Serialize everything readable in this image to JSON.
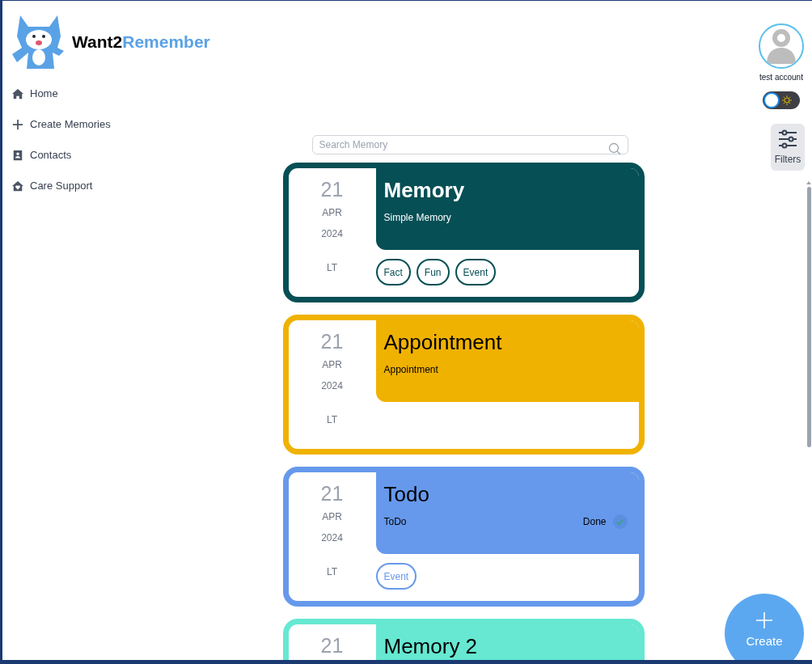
{
  "brand": {
    "part1": "Want2",
    "part2": "Remember"
  },
  "nav": [
    {
      "label": "Home"
    },
    {
      "label": "Create Memories"
    },
    {
      "label": "Contacts"
    },
    {
      "label": "Care Support"
    }
  ],
  "account": {
    "name": "test account"
  },
  "theme_toggle": {
    "on": false
  },
  "filters": {
    "label": "Filters"
  },
  "search": {
    "placeholder": "Search Memory"
  },
  "cards": [
    {
      "color": "#054f55",
      "day": "21",
      "month": "APR",
      "year": "2024",
      "tz": "LT",
      "title": "Memory",
      "subtitle": "Simple Memory",
      "tags": [
        "Fact",
        "Fun",
        "Event"
      ]
    },
    {
      "color": "#f0b200",
      "day": "21",
      "month": "APR",
      "year": "2024",
      "tz": "LT",
      "title": "Appointment",
      "subtitle": "Appointment"
    },
    {
      "color": "#6699ec",
      "day": "21",
      "month": "APR",
      "year": "2024",
      "tz": "LT",
      "title": "Todo",
      "subtitle": "ToDo",
      "done": {
        "label": "Done",
        "checked": true
      },
      "tags": [
        "Event"
      ]
    },
    {
      "color": "#66e8d2",
      "day": "21",
      "title": "Memory 2"
    }
  ],
  "create_button": {
    "label": "Create"
  }
}
